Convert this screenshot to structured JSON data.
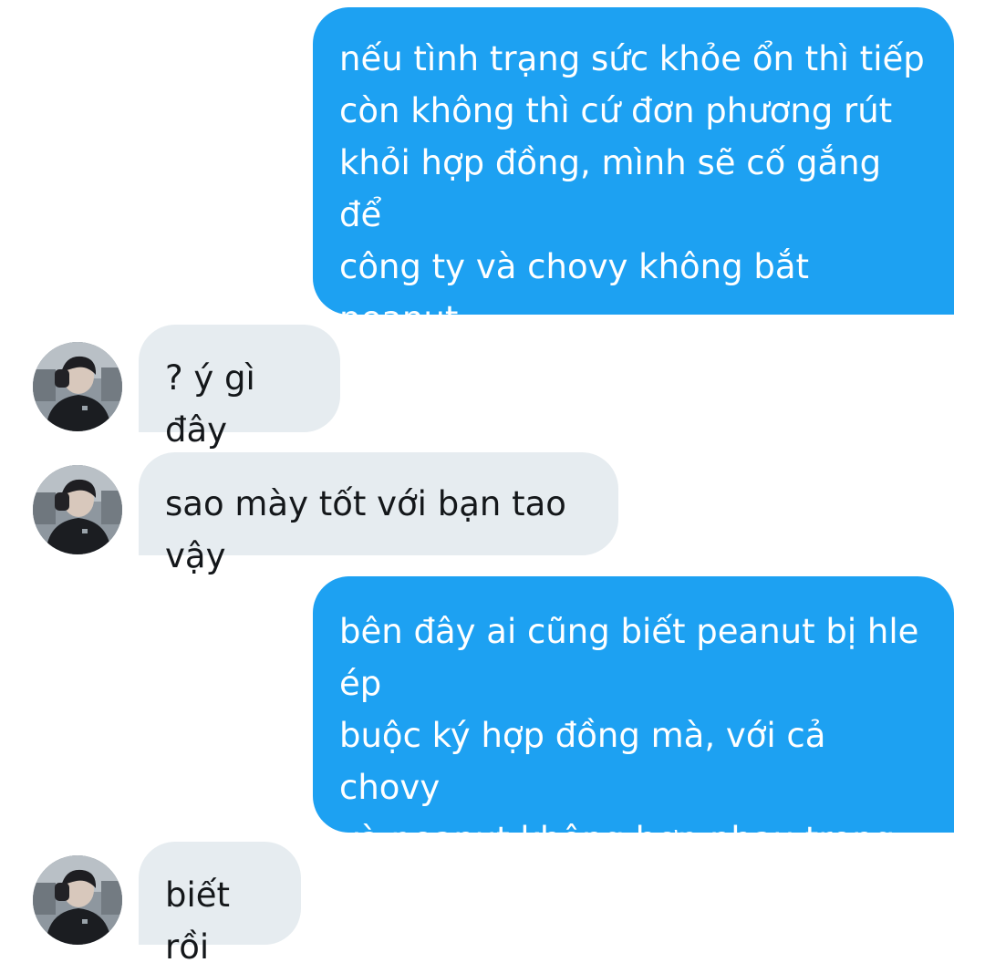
{
  "conversation": {
    "messages": [
      {
        "direction": "outgoing",
        "text": "nếu tình trạng sức khỏe ổn thì tiếp\ncòn không thì cứ đơn phương rút\nkhỏi hợp đồng, mình sẽ cố gắng để\ncông ty và chovy không bắt peanut\nđền vi phạm hợp đồng"
      },
      {
        "direction": "incoming",
        "text": "? ý gì đây",
        "avatar": "user-avatar-photo"
      },
      {
        "direction": "incoming",
        "text": "sao mày tốt với bạn tao vậy",
        "avatar": "user-avatar-photo"
      },
      {
        "direction": "outgoing",
        "text": "bên đây ai cũng biết peanut bị hle ép\nbuộc ký hợp đồng mà, với cả chovy\nvà peanut không hợp nhau trong\ncông tác làm nhạc"
      },
      {
        "direction": "incoming",
        "text": "biết rồi",
        "avatar": "user-avatar-photo"
      }
    ]
  },
  "colors": {
    "outgoing_bubble": "#1da1f2",
    "incoming_bubble": "#e6ecf0",
    "outgoing_text": "#ffffff",
    "incoming_text": "#14171a",
    "background": "#ffffff"
  }
}
